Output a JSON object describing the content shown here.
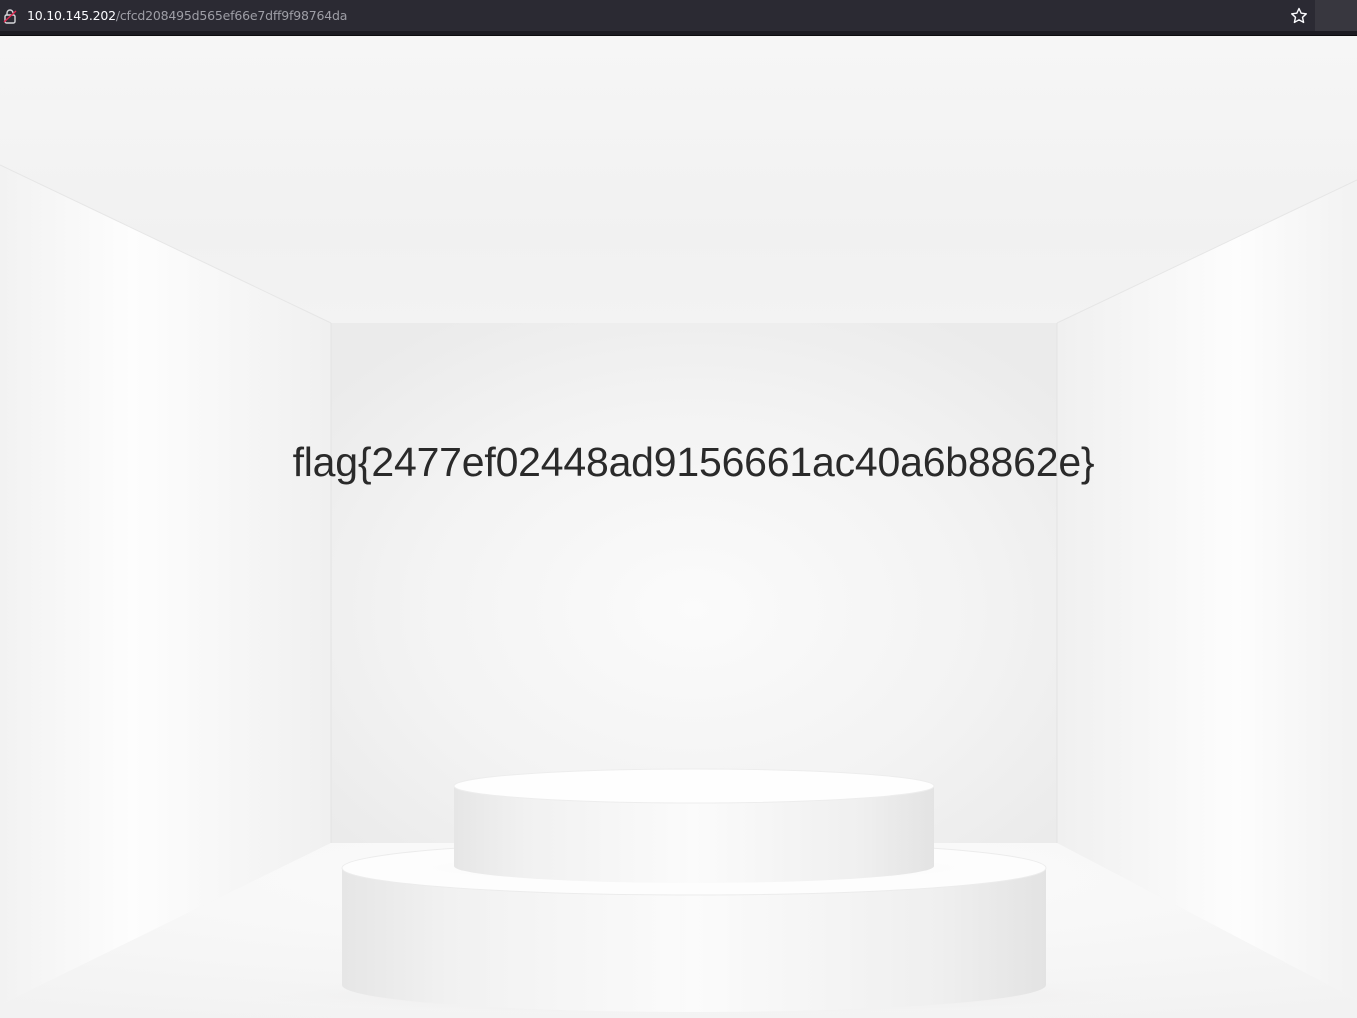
{
  "browser": {
    "url_host": "10.10.145.202",
    "url_path": "/cfcd208495d565ef66e7dff9f98764da",
    "icons": [
      "lock-warning-icon",
      "bookmark-star-icon"
    ]
  },
  "page": {
    "flag_text": "flag{2477ef02448ad9156661ac40a6b8862e}"
  }
}
